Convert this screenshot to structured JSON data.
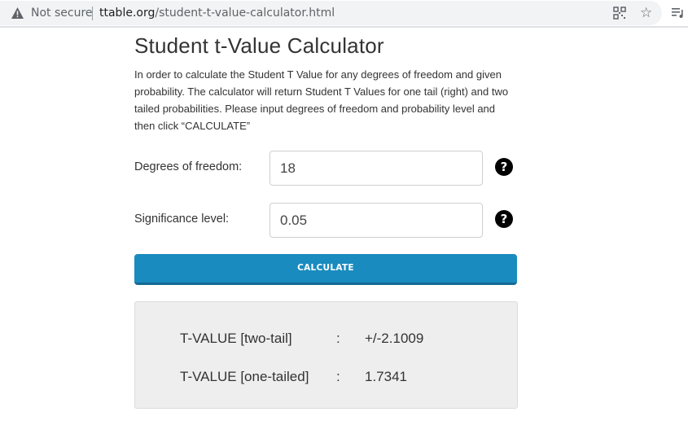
{
  "browser": {
    "security_text": "Not secure",
    "url_domain": "ttable.org",
    "url_path": "/student-t-value-calculator.html",
    "icons": [
      "warning-icon",
      "qr-code-icon",
      "star-icon",
      "reading-list-icon"
    ]
  },
  "page": {
    "title": "Student t-Value Calculator",
    "intro": "In order to calculate the Student T Value for any degrees of freedom and given probability. The calculator will return Student T Values for one tail (right) and two tailed probabilities. Please input degrees of freedom and probability level and then click “CALCULATE”"
  },
  "form": {
    "dof_label": "Degrees of freedom:",
    "dof_value": "18",
    "sig_label": "Significance level:",
    "sig_value": "0.05",
    "help_glyph": "?",
    "calculate_label": "CALCULATE"
  },
  "results": {
    "two_tail_label": "T-VALUE [two-tail]",
    "two_tail_value": "+/-2.1009",
    "one_tail_label": "T-VALUE [one-tailed]",
    "one_tail_value": "1.7341",
    "separator": ":"
  },
  "colors": {
    "button": "#1a8bbf",
    "result_bg": "#eeeeee"
  }
}
